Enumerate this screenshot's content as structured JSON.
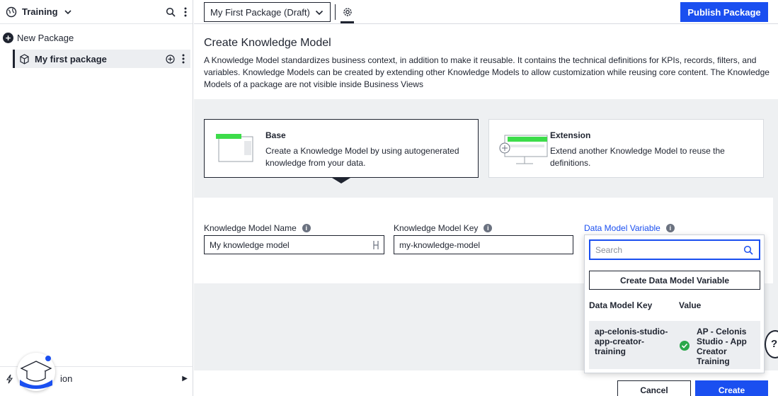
{
  "sidebar": {
    "workspace_title": "Training",
    "new_package_label": "New Package",
    "package_item_label": "My first package",
    "footer_label": "ion"
  },
  "topbar": {
    "package_select_value": "My First Package (Draft)",
    "publish_label": "Publish Package"
  },
  "main": {
    "title": "Create Knowledge Model",
    "description": "A Knowledge Model standardizes business context, in addition to make it reusable. It contains the technical definitions for KPIs, records, filters, and variables. Knowledge Models can be created by extending other Knowledge Models to allow customization while reusing core content. The Knowledge Models of a package are not visible inside Business Views",
    "cards": [
      {
        "title": "Base",
        "description": "Create a Knowledge Model by using autogenerated knowledge from your data."
      },
      {
        "title": "Extension",
        "description": "Extend another Knowledge Model to reuse the definitions."
      }
    ],
    "fields": {
      "name_label": "Knowledge Model Name",
      "name_value": "My knowledge model",
      "key_label": "Knowledge Model Key",
      "key_value": "my-knowledge-model",
      "variable_label": "Data Model Variable"
    },
    "cancel_label": "Cancel",
    "create_label": "Create"
  },
  "dropdown": {
    "search_placeholder": "Search",
    "create_variable_label": "Create Data Model Variable",
    "col_key": "Data Model Key",
    "col_value": "Value",
    "rows": [
      {
        "key": "ap-celonis-studio-app-creator-training",
        "value": "AP - Celonis Studio - App Creator Training"
      }
    ]
  },
  "colors": {
    "accent": "#1a4ff0",
    "success": "#2aa84a",
    "illustration_green": "#3ddc4a",
    "panel_gray": "#eef0f2"
  },
  "help_label": "?"
}
